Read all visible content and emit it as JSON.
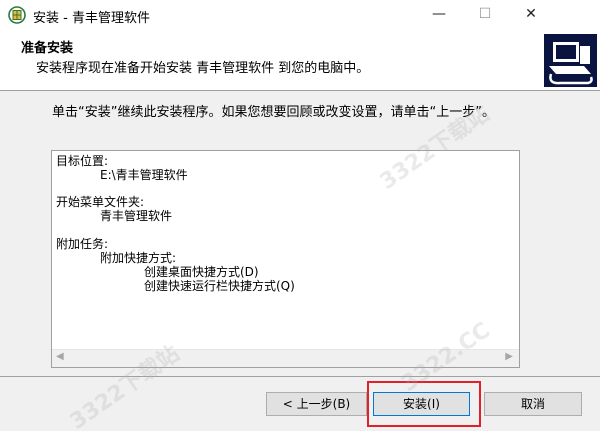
{
  "window": {
    "title": "安装 - 青丰管理软件",
    "controls": {
      "minimize": "—",
      "maximize": "☐",
      "close": "✕"
    }
  },
  "header": {
    "title": "准备安装",
    "subtitle": "安装程序现在准备开始安装 青丰管理软件 到您的电脑中。"
  },
  "body": {
    "intro": "单击“安装”继续此安装程序。如果您想要回顾或改变设置，请单击“上一步”。",
    "memo": {
      "dest_label": "目标位置:",
      "dest_value": "E:\\青丰管理软件",
      "menu_label": "开始菜单文件夹:",
      "menu_value": "青丰管理软件",
      "tasks_label": "附加任务:",
      "tasks_group": "附加快捷方式:",
      "task_1": "创建桌面快捷方式(D)",
      "task_2": "创建快速运行栏快捷方式(Q)"
    }
  },
  "footer": {
    "back_label": "< 上一步(B)",
    "install_label": "安装(I)",
    "cancel_label": "取消"
  },
  "watermark": {
    "text": "3322下载站",
    "text2": "3322.CC"
  },
  "colors": {
    "highlight": "#e0202a",
    "focus": "#0078d7",
    "background": "#f0f0f0"
  },
  "icons": [
    "app-icon",
    "setup-computer-icon",
    "scroll-left-icon",
    "scroll-right-icon"
  ]
}
